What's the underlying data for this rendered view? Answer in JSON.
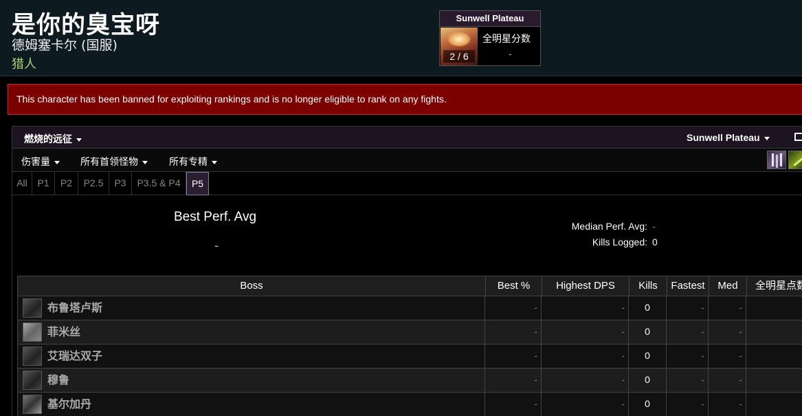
{
  "character": {
    "name": "是你的臭宝呀",
    "realm": "德姆塞卡尔 (国服)",
    "class": "猎人"
  },
  "zone_box": {
    "title": "Sunwell Plateau",
    "progress": "2 / 6",
    "label": "全明星分数",
    "value": "-"
  },
  "banner": "This character has been banned for exploiting rankings and is no longer eligible to rank on any fights.",
  "panel": {
    "expansion": "燃烧的远征",
    "zone": "Sunwell Plateau",
    "filters": [
      "伤害量",
      "所有首领怪物",
      "所有专精"
    ],
    "spec_icons": [
      "priest-spec-icon",
      "hunter-spec-icon"
    ],
    "phases": [
      "All",
      "P1",
      "P2",
      "P2.5",
      "P3",
      "P3.5 & P4",
      "P5"
    ],
    "active_phase": "P5"
  },
  "stats": {
    "best_title": "Best Perf. Avg",
    "best_value": "-",
    "median_label": "Median Perf. Avg:",
    "median_value": "-",
    "kills_label": "Kills Logged:",
    "kills_value": "0"
  },
  "table": {
    "headers": [
      "Boss",
      "Best %",
      "Highest DPS",
      "Kills",
      "Fastest",
      "Med",
      "全明星点数"
    ],
    "rows": [
      {
        "boss": "布鲁塔卢斯",
        "best": "-",
        "dps": "-",
        "kills": "0",
        "fastest": "-",
        "med": "-",
        "points": "-"
      },
      {
        "boss": "菲米丝",
        "best": "-",
        "dps": "-",
        "kills": "0",
        "fastest": "-",
        "med": "-",
        "points": "-"
      },
      {
        "boss": "艾瑞达双子",
        "best": "-",
        "dps": "-",
        "kills": "0",
        "fastest": "-",
        "med": "-",
        "points": "-"
      },
      {
        "boss": "穆鲁",
        "best": "-",
        "dps": "-",
        "kills": "0",
        "fastest": "-",
        "med": "-",
        "points": "-"
      },
      {
        "boss": "基尔加丹",
        "best": "-",
        "dps": "-",
        "kills": "0",
        "fastest": "-",
        "med": "-",
        "points": "-"
      }
    ]
  }
}
